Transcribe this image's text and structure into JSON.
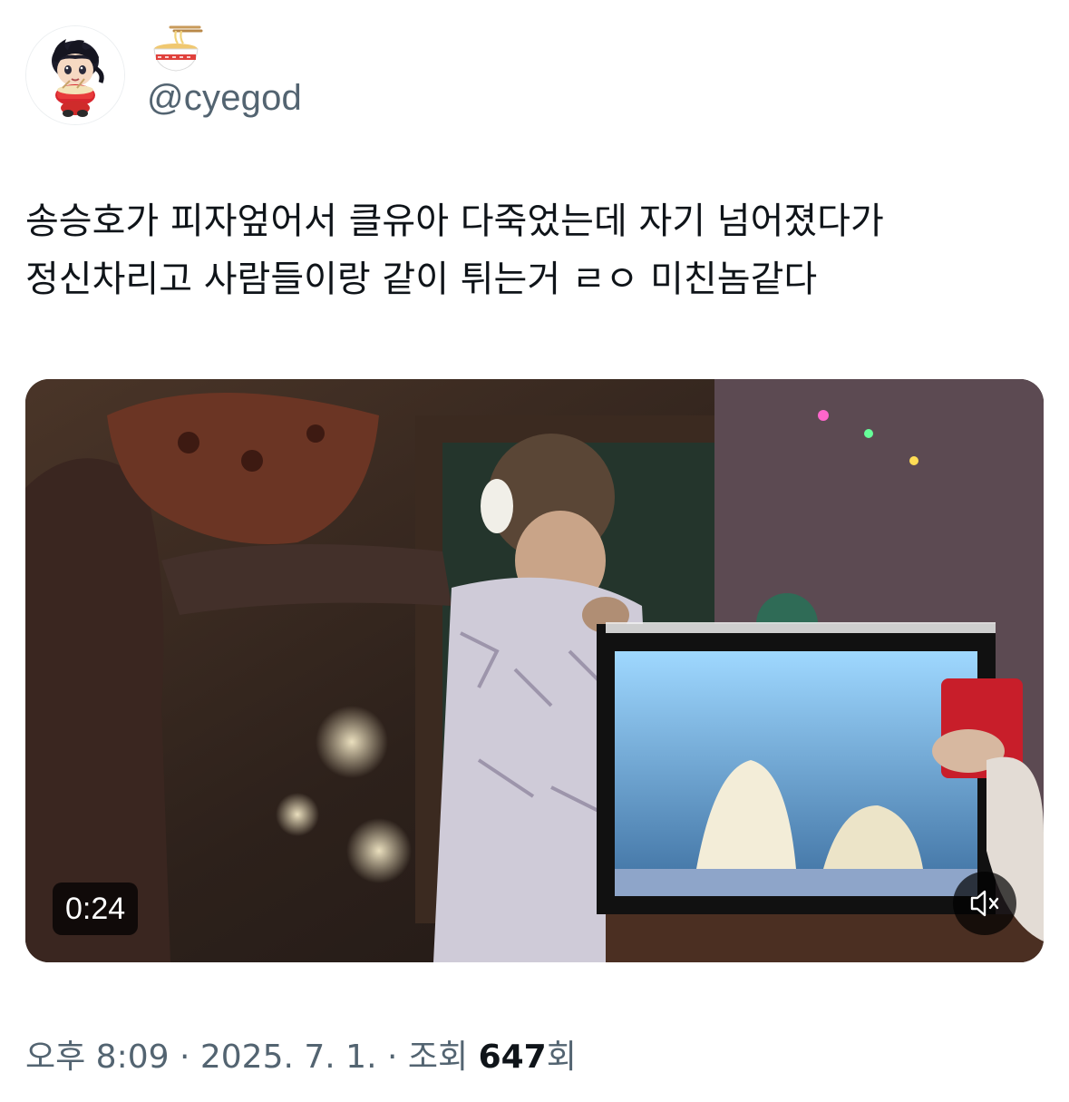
{
  "user": {
    "display_name_icon": "ramen-bowl-icon",
    "handle": "@cyegod",
    "avatar_icon": "cartoon-character-avatar"
  },
  "tweet": {
    "text": "송승호가 피자엎어서 클유아 다죽었는데 자기 넘어졌다가\n정신차리고 사람들이랑 같이 튀는거 ㄹㅇ 미친놈같다"
  },
  "media": {
    "type": "video",
    "duration": "0:24",
    "mute_icon": "speaker-muted-icon"
  },
  "meta": {
    "time": "오후 8:09",
    "sep1": " · ",
    "date": "2025. 7. 1.",
    "sep2": " · ",
    "views_label": "조회 ",
    "views_count": "647",
    "views_suffix": "회"
  },
  "colors": {
    "text": "#0f1419",
    "secondary": "#536471",
    "overlay": "#000000"
  }
}
